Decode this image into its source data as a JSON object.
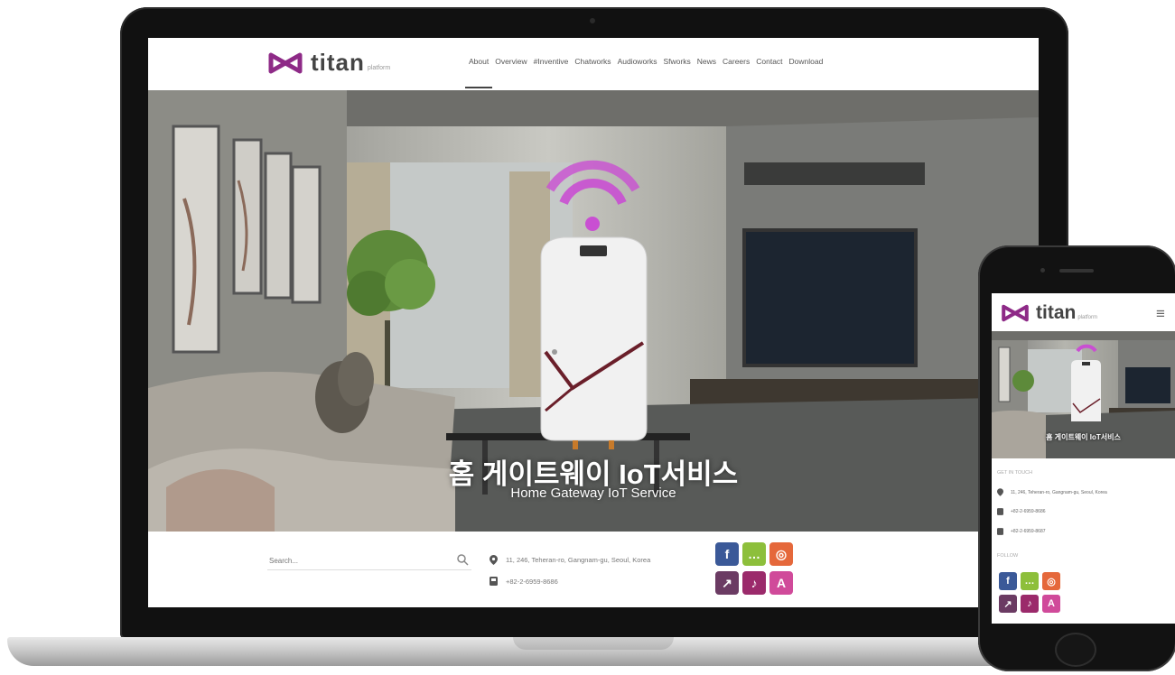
{
  "brand": {
    "name": "titan",
    "tagline": "platform",
    "accent": "#8e2a87"
  },
  "nav": {
    "items": [
      "About",
      "Overview",
      "#Inventive",
      "Chatworks",
      "Audioworks",
      "Sfworks",
      "News",
      "Careers",
      "Contact",
      "Download"
    ],
    "active_index": 0
  },
  "hero": {
    "title": "홈 게이트웨이 IoT서비스",
    "subtitle": "Home Gateway IoT Service",
    "wifi_color": "#c94fd2"
  },
  "footer": {
    "search_placeholder": "Search...",
    "address": "11, 246, Teheran-ro, Gangnam-gu, Seoul, Korea",
    "phone": "+82-2-6959-8686"
  },
  "social": [
    {
      "icon": "facebook-icon",
      "glyph": "f",
      "color": "#3b5998"
    },
    {
      "icon": "chat-icon",
      "glyph": "…",
      "color": "#8dbf3b"
    },
    {
      "icon": "instagram-icon",
      "glyph": "◎",
      "color": "#e5683b"
    },
    {
      "icon": "app-icon-1",
      "glyph": "↗",
      "color": "#6b3b63"
    },
    {
      "icon": "app-icon-2",
      "glyph": "♪",
      "color": "#9b2a6b"
    },
    {
      "icon": "app-icon-3",
      "glyph": "A",
      "color": "#d04a9a"
    }
  ],
  "mobile": {
    "hero_title": "홈 게이트웨이 IoT서비스",
    "section_contact": "GET IN TOUCH",
    "address": "11, 246, Teheran-ro, Gangnam-gu, Seoul, Korea",
    "phone": "+82-2-6959-8686",
    "fax": "+82-2-6959-8687",
    "section_follow": "FOLLOW"
  }
}
